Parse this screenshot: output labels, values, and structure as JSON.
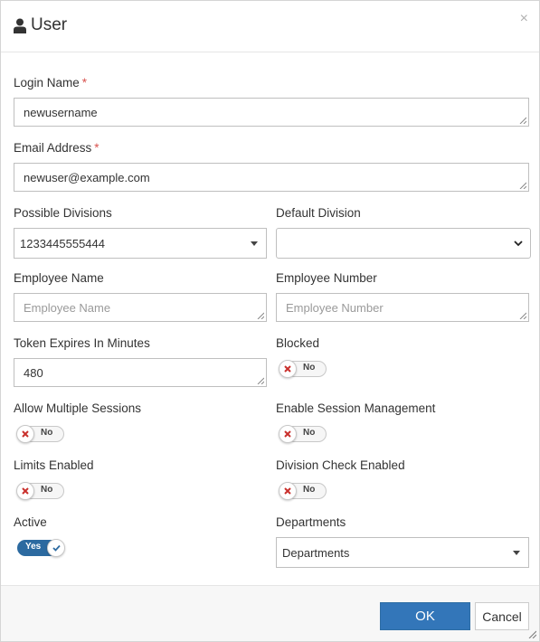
{
  "dialog": {
    "title": "User",
    "close_glyph": "×"
  },
  "icons": {
    "title_icon": "user-icon",
    "close_icon": "close-icon",
    "toggle_off_icon": "x-icon",
    "toggle_on_icon": "check-icon"
  },
  "colors": {
    "required": "#d9534f",
    "primary": "#3376b9",
    "toggle_on": "#2c6aa0",
    "toggle_off_x": "#c9302c"
  },
  "fields": {
    "login_name": {
      "label": "Login Name",
      "required": "*",
      "value": "newusername"
    },
    "email": {
      "label": "Email Address",
      "required": "*",
      "value": "newuser@example.com"
    },
    "possible_divisions": {
      "label": "Possible Divisions",
      "value": "1233445555444"
    },
    "default_division": {
      "label": "Default Division",
      "value": ""
    },
    "employee_name": {
      "label": "Employee Name",
      "placeholder": "Employee Name"
    },
    "employee_number": {
      "label": "Employee Number",
      "placeholder": "Employee Number"
    },
    "token_expires": {
      "label": "Token Expires In Minutes",
      "value": "480"
    },
    "blocked": {
      "label": "Blocked",
      "state": "No"
    },
    "allow_multiple_sessions": {
      "label": "Allow Multiple Sessions",
      "state": "No"
    },
    "enable_session_management": {
      "label": "Enable Session Management",
      "state": "No"
    },
    "limits_enabled": {
      "label": "Limits Enabled",
      "state": "No"
    },
    "division_check_enabled": {
      "label": "Division Check Enabled",
      "state": "No"
    },
    "active": {
      "label": "Active",
      "state": "Yes"
    },
    "departments": {
      "label": "Departments",
      "value": "Departments"
    }
  },
  "footer": {
    "ok_label": "OK",
    "cancel_label": "Cancel"
  }
}
